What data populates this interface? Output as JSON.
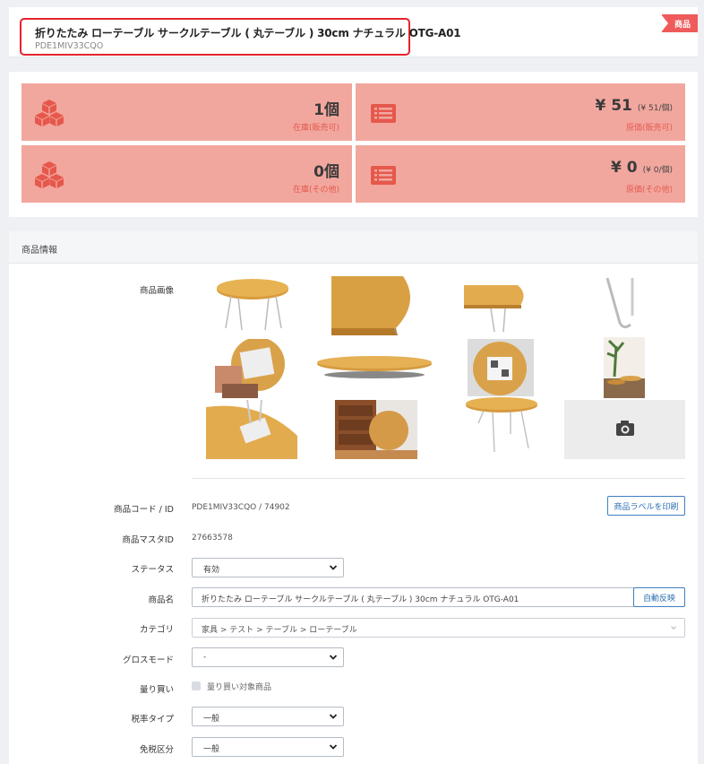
{
  "header": {
    "title": "折りたたみ ローテーブル サークルテーブル ( 丸テーブル ) 30cm ナチュラル OTG-A01",
    "code": "PDE1MIV33CQO",
    "ribbon": "商品"
  },
  "stats": [
    {
      "value": "1個",
      "sub": "",
      "caption": "在庫(販売可)",
      "icon": "boxes-icon"
    },
    {
      "value": "¥ 51",
      "sub": "(¥ 51/個)",
      "caption": "原価(販売可)",
      "icon": "list-card-icon"
    },
    {
      "value": "0個",
      "sub": "",
      "caption": "在庫(その他)",
      "icon": "boxes-icon"
    },
    {
      "value": "¥ 0",
      "sub": "(¥ 0/個)",
      "caption": "原価(その他)",
      "icon": "list-card-icon"
    }
  ],
  "colors": {
    "stat_bg": "#f2a79e",
    "stat_icon": "#e6584c",
    "ribbon": "#ef5b5b",
    "highlight": "#e5232e",
    "link": "#2f6fb3"
  },
  "info": {
    "heading": "商品情報",
    "images_label": "商品画像",
    "camera_icon": "camera-icon",
    "code_label": "商品コード / ID",
    "code_value": "PDE1MIV33CQO / 74902",
    "print_label_button": "商品ラベルを印刷",
    "master_label": "商品マスタID",
    "master_value": "27663578",
    "status_label": "ステータス",
    "status_value": "有効",
    "name_label": "商品名",
    "name_value": "折りたたみ ローテーブル サークルテーブル ( 丸テーブル ) 30cm ナチュラル OTG-A01",
    "auto_reflect_button": "自動反映",
    "category_label": "カテゴリ",
    "category_value": "家具 > テスト > テーブル > ローテーブル",
    "gross_label": "グロスモード",
    "gross_value": "-",
    "buyback_label": "量り買い",
    "buyback_checkbox_label": "量り買い対象商品",
    "tax_type_label": "税率タイプ",
    "tax_type_value": "一般",
    "tax_exempt_label": "免税区分",
    "tax_exempt_value": "一般"
  }
}
